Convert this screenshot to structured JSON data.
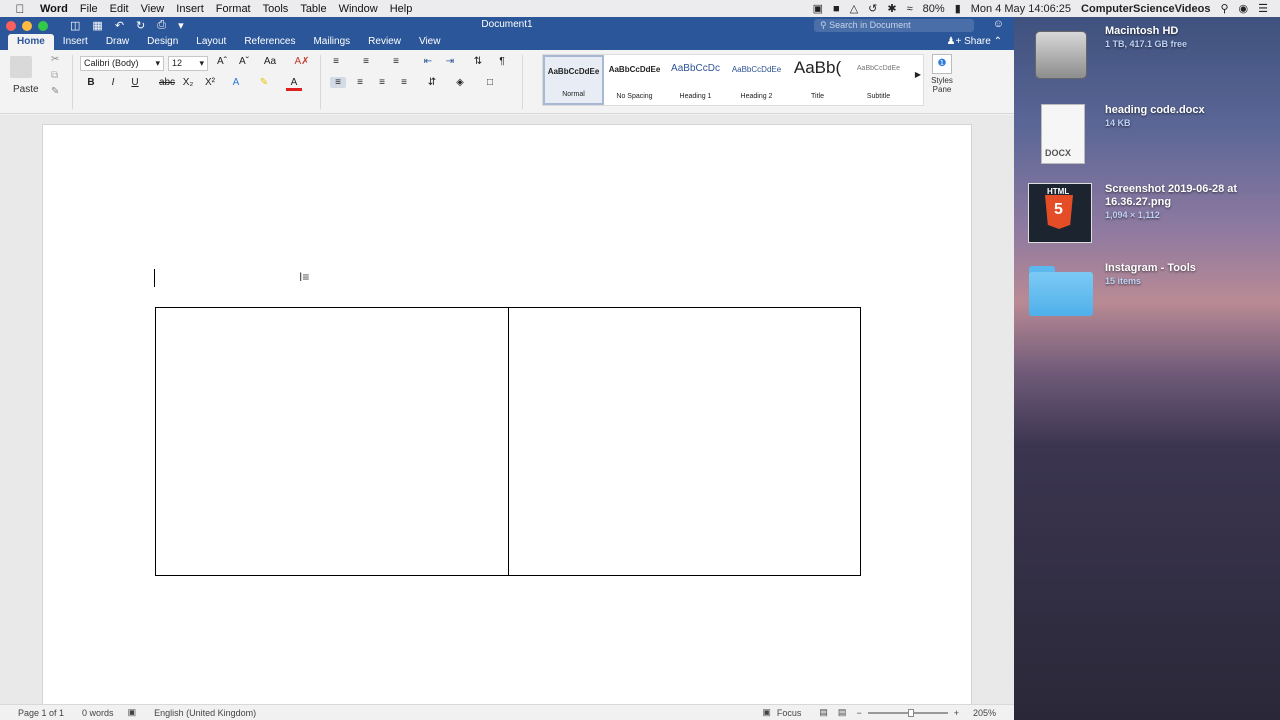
{
  "menubar": {
    "items": [
      "Word",
      "File",
      "Edit",
      "View",
      "Insert",
      "Format",
      "Tools",
      "Table",
      "Window",
      "Help"
    ],
    "battery": "80%",
    "clock": "Mon 4 May  14:06:25",
    "user": "ComputerScienceVideos"
  },
  "window": {
    "title": "Document1",
    "search_placeholder": "Search in Document",
    "tabs": [
      "Home",
      "Insert",
      "Draw",
      "Design",
      "Layout",
      "References",
      "Mailings",
      "Review",
      "View"
    ],
    "share_label": "Share"
  },
  "ribbon": {
    "paste_label": "Paste",
    "font_name": "Calibri (Body)",
    "font_size": "12",
    "styles": [
      {
        "preview": "AaBbCcDdEe",
        "name": "Normal"
      },
      {
        "preview": "AaBbCcDdEe",
        "name": "No Spacing"
      },
      {
        "preview": "AaBbCcDc",
        "name": "Heading 1"
      },
      {
        "preview": "AaBbCcDdEe",
        "name": "Heading 2"
      },
      {
        "preview": "AaBb(",
        "name": "Title"
      },
      {
        "preview": "AaBbCcDdEe",
        "name": "Subtitle"
      }
    ],
    "styles_pane_label": "Styles Pane"
  },
  "status": {
    "page": "Page 1 of 1",
    "words": "0 words",
    "language": "English (United Kingdom)",
    "focus_label": "Focus",
    "zoom": "205%"
  },
  "desktop": [
    {
      "name": "Macintosh HD",
      "sub": "1 TB, 417.1 GB free"
    },
    {
      "name": "heading code.docx",
      "sub": "14 KB",
      "badge": "DOCX"
    },
    {
      "name": "Screenshot 2019-06-28 at 16.36.27.png",
      "sub": "1,094 × 1,112",
      "badge": "HTML"
    },
    {
      "name": "Instagram - Tools",
      "sub": "15 items"
    }
  ]
}
